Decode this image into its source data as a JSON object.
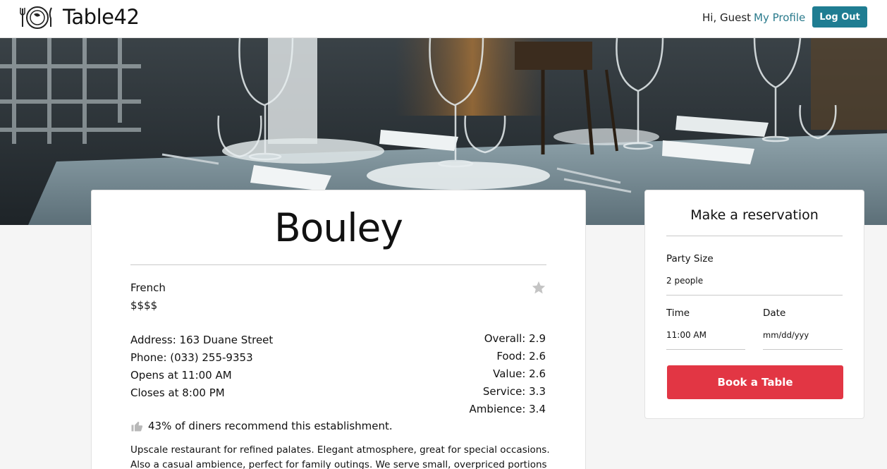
{
  "header": {
    "brand": "Table42",
    "greeting": "Hi, Guest",
    "profile_link": "My Profile",
    "logout_label": "Log Out"
  },
  "restaurant": {
    "name": "Bouley",
    "cuisine": "French",
    "price": "$$$$",
    "address": "Address: 163 Duane Street",
    "phone": "Phone: (033) 255-9353",
    "opens": "Opens at 11:00 AM",
    "closes": "Closes at 8:00 PM",
    "ratings": {
      "overall": "Overall: 2.9",
      "food": "Food: 2.6",
      "value": "Value: 2.6",
      "service": "Service: 3.3",
      "ambience": "Ambience: 3.4"
    },
    "recommend": "43% of diners recommend this establishment.",
    "description": "Upscale restaurant for refined palates. Elegant atmosphere, great for special occasions. Also a casual ambience, perfect for family outings. We serve small, overpriced portions"
  },
  "reservation": {
    "title": "Make a reservation",
    "party_label": "Party Size",
    "party_value": "2 people",
    "time_label": "Time",
    "time_value": "11:00 AM",
    "date_label": "Date",
    "date_value": "mm/dd/yyy",
    "book_label": "Book a Table"
  },
  "icons": {
    "logo": "plate-fork-knife-icon",
    "favorite": "star-icon",
    "recommend": "thumbs-up-icon"
  },
  "colors": {
    "accent": "#1f7d92",
    "book_button": "#e23644",
    "link": "#2a7a8c",
    "star": "#c4c4c4"
  }
}
